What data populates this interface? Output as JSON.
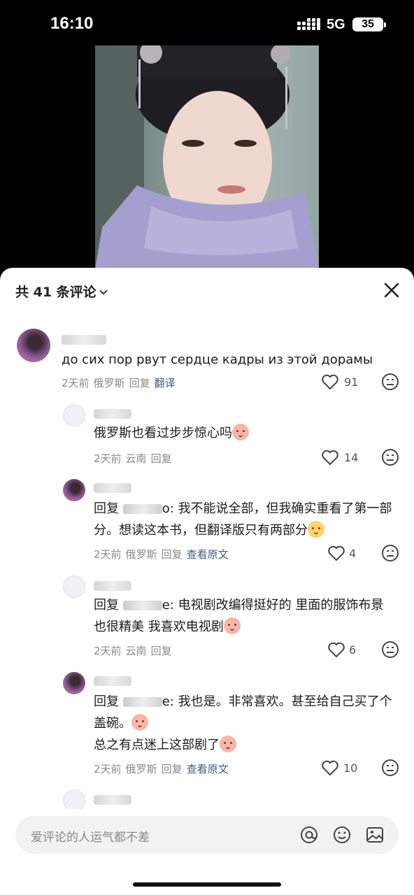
{
  "status_bar": {
    "time": "16:10",
    "network": "5G",
    "battery": "35"
  },
  "sheet": {
    "title": "共 41 条评论"
  },
  "comments": [
    {
      "text": "до сих пор рвут сердце кадры из этой дорамы",
      "time": "2天前",
      "location": "俄罗斯",
      "reply": "回复",
      "extra": "翻译",
      "likes": "91"
    },
    {
      "text": "俄罗斯也看过步步惊心吗",
      "time": "2天前",
      "location": "云南",
      "reply": "回复",
      "extra": "",
      "likes": "14"
    },
    {
      "prefix": "回复",
      "line1": "o: 我不能说全部，但我确实重看了第一部",
      "line2": "分。想读这本书，但翻译版只有两部分",
      "time": "2天前",
      "location": "俄罗斯",
      "reply": "回复",
      "extra": "查看原文",
      "likes": "4"
    },
    {
      "prefix": "回复",
      "line1": "e: 电视剧改编得挺好的 里面的服饰布景",
      "line2": "也很精美 我喜欢电视剧",
      "time": "2天前",
      "location": "云南",
      "reply": "回复",
      "extra": "",
      "likes": "6"
    },
    {
      "prefix": "回复",
      "line1": "e: 我也是。非常喜欢。甚至给自己买了个",
      "line2": "盖碗。",
      "line3": "总之有点迷上这部剧了",
      "time": "2天前",
      "location": "俄罗斯",
      "reply": "回复",
      "extra": "查看原文",
      "likes": "10"
    }
  ],
  "input": {
    "placeholder": "爱评论的人运气都不差"
  },
  "icons": [
    "signal-icon",
    "battery-icon",
    "chevron-down-icon",
    "close-icon",
    "heart-icon",
    "dislike-face-icon",
    "at-icon",
    "emoji-icon",
    "image-icon"
  ],
  "colors": {
    "link": "#3d5a80",
    "meta": "#8a8a8a"
  }
}
